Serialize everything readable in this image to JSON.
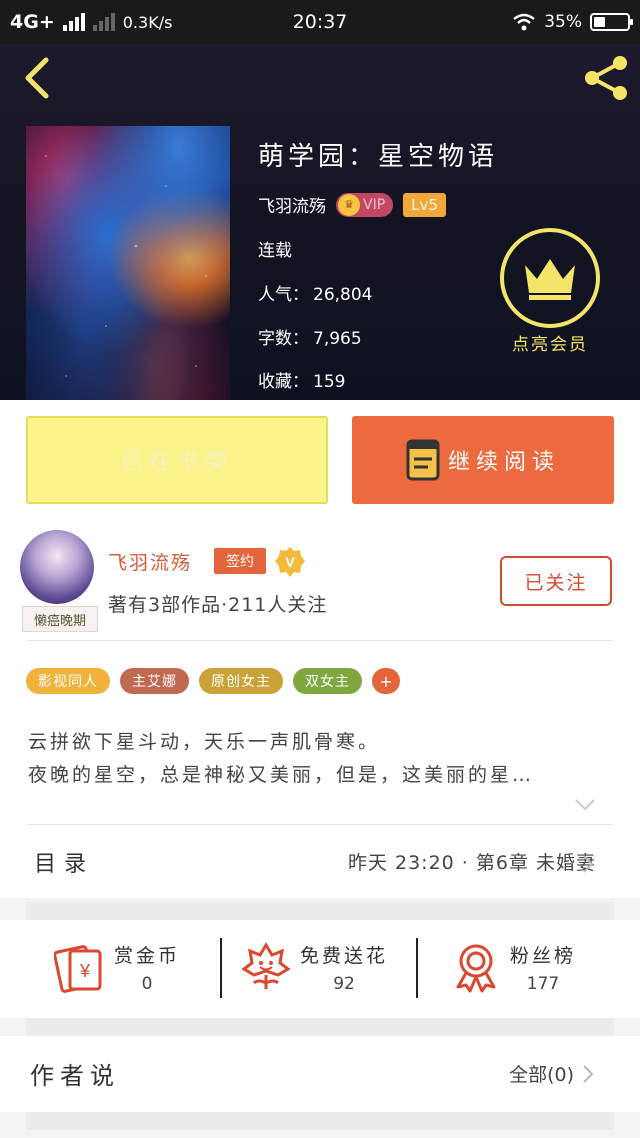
{
  "status_bar": {
    "network": "4G+",
    "speed": "0.3K/s",
    "time": "20:37",
    "battery": "35%",
    "battery_level": 0.35
  },
  "book": {
    "title": "萌学园：星空物语",
    "author": "飞羽流殇",
    "vip_label": "VIP",
    "level": "Lv5",
    "status": "连载",
    "popularity_label": "人气：",
    "popularity": "26,804",
    "words_label": "字数：",
    "words": "7,965",
    "favorites_label": "收藏：",
    "favorites": "159"
  },
  "vip_promo": {
    "label": "点亮会员",
    "color": "#f5e46a"
  },
  "actions": {
    "shelf_label": "已在书架",
    "read_label": "继续阅读"
  },
  "author": {
    "name": "飞羽流殇",
    "badge": "签约",
    "v_badge": "V",
    "avatar_caption": "懒癌晚期",
    "stats": "著有3部作品·211人关注",
    "follow_label": "已关注"
  },
  "tags": [
    {
      "label": "影视同人",
      "color": "#f0b23a"
    },
    {
      "label": "主艾娜",
      "color": "#c06a52"
    },
    {
      "label": "原创女主",
      "color": "#c9a33a"
    },
    {
      "label": "双女主",
      "color": "#7fa73e"
    }
  ],
  "tag_add": "+",
  "intro": [
    "云拼欲下星斗动，天乐一声肌骨寒。",
    "夜晚的星空，总是神秘又美丽，但是，这美丽的星…"
  ],
  "toc": {
    "label": "目录",
    "latest": "昨天 23:20 · 第6章 未婚妻"
  },
  "stats": [
    {
      "icon": "red-envelope-icon",
      "label": "赏金币",
      "value": "0"
    },
    {
      "icon": "flower-icon",
      "label": "免费送花",
      "value": "92"
    },
    {
      "icon": "ribbon-badge-icon",
      "label": "粉丝榜",
      "value": "177"
    }
  ],
  "author_says": {
    "label": "作者说",
    "all_label": "全部(0)"
  },
  "colors": {
    "accent": "#ec6a3d",
    "shelf_button": "#fbf48a",
    "follow_border": "#d44a30",
    "icon_red": "#d9482f"
  }
}
